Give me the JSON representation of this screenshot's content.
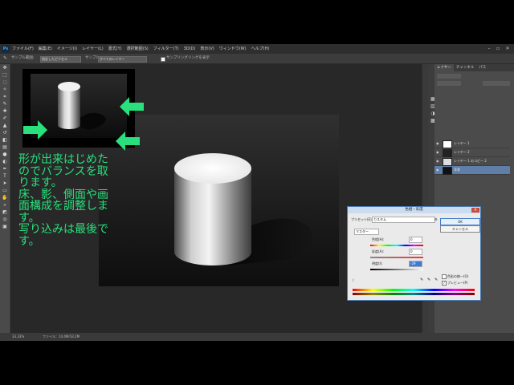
{
  "menubar": {
    "logo": "Ps",
    "items": [
      "ファイル(F)",
      "編集(E)",
      "イメージ(I)",
      "レイヤー(L)",
      "書式(Y)",
      "選択範囲(S)",
      "フィルター(T)",
      "3D(D)",
      "表示(V)",
      "ウィンドウ(W)",
      "ヘルプ(H)"
    ],
    "window_controls": [
      "–",
      "▫",
      "✕"
    ]
  },
  "options_bar": {
    "sample_label": "サンプル範囲:",
    "sample_value": "指定したピクセル",
    "layer_label": "サンプル:",
    "layer_value": "すべてのレイヤー",
    "ring_label": "サンプリングリングを表示"
  },
  "overlay_text": "形が出来はじめた\nのでバランスを取\nります。\n床、影、側面や画\n面構成を調整しま\nす。\n写り込みは最後で\nす。",
  "statusbar": {
    "zoom": "33.33%",
    "doc_info": "ファイル：14.4M/33.2M"
  },
  "layers_panel": {
    "tabs": [
      "レイヤー",
      "チャンネル",
      "パス"
    ],
    "layers": [
      {
        "name": "レイヤー 1",
        "selected": false
      },
      {
        "name": "レイヤー 2",
        "selected": false
      },
      {
        "name": "レイヤー 1 のコピー 2",
        "selected": false
      },
      {
        "name": "背景",
        "selected": true
      }
    ]
  },
  "dialog": {
    "title": "色相・彩度",
    "preset_label": "プリセット(E):",
    "preset_value": "カスタム",
    "channel_value": "マスター",
    "hue_label": "色相(H):",
    "hue_value": "0",
    "saturation_label": "彩度(A):",
    "saturation_value": "0",
    "lightness_label": "明度(I):",
    "lightness_value": "-29",
    "ok_label": "OK",
    "cancel_label": "キャンセル",
    "colorize_label": "色彩の統一(O)",
    "preview_label": "プレビュー(P)"
  },
  "colors": {
    "overlay_text": "#29e07c",
    "arrow": "#29e07c",
    "selection": "#5f7ea8"
  }
}
